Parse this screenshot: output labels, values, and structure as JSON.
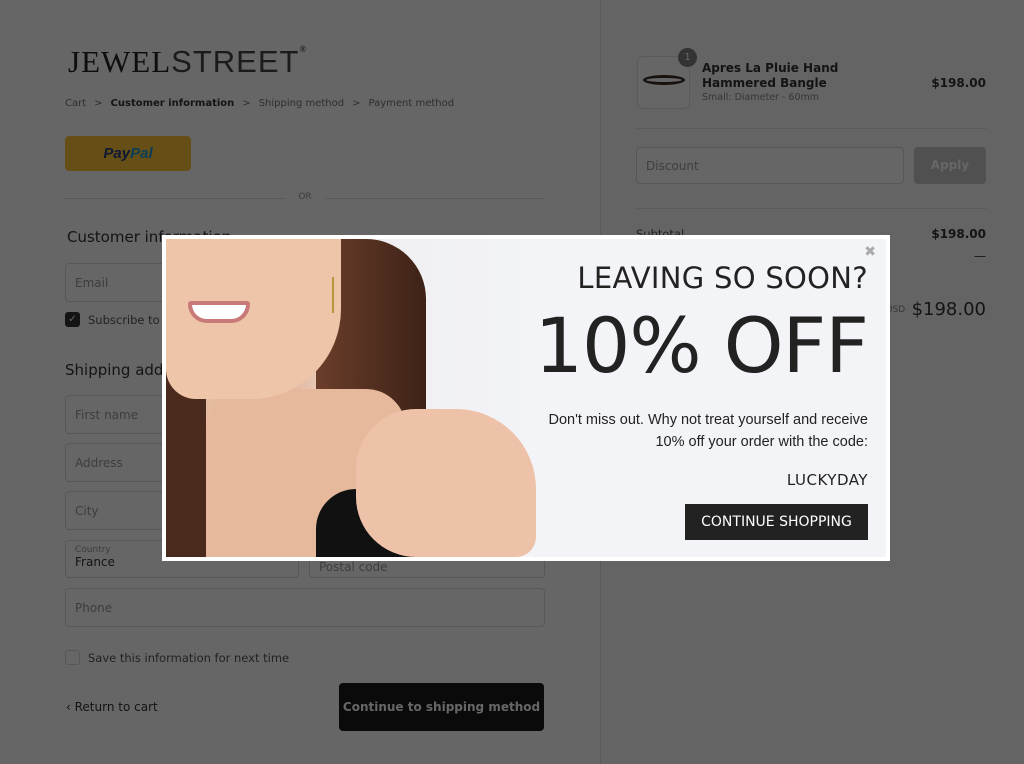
{
  "brand": {
    "logo_bold": "JEWEL",
    "logo_light": "STREET",
    "reg": "®"
  },
  "breadcrumb": [
    {
      "label": "Cart"
    },
    {
      "label": "Customer information"
    },
    {
      "label": "Shipping method"
    },
    {
      "label": "Payment method"
    }
  ],
  "breadcrumb_sep": ">",
  "paypal": {
    "part1": "Pay",
    "part2": "Pal"
  },
  "or": "OR",
  "customer": {
    "heading": "Customer information",
    "email_placeholder": "Email",
    "subscribe_label": "Subscribe to our newsletter",
    "subscribe_checked": true
  },
  "shipping": {
    "heading": "Shipping address",
    "first_name": "First name",
    "address": "Address",
    "city": "City",
    "country_label": "Country",
    "country_value": "France",
    "postal": "Postal code",
    "phone": "Phone",
    "save_label": "Save this information for next time",
    "save_checked": false
  },
  "actions": {
    "return": "Return to cart",
    "continue": "Continue to shipping method"
  },
  "cart": {
    "qty": "1",
    "name": "Apres La Pluie Hand Hammered Bangle",
    "variant": "Small: Diameter - 60mm",
    "price": "$198.00",
    "discount_placeholder": "Discount",
    "apply": "Apply",
    "subtotal_label": "Subtotal",
    "subtotal": "$198.00",
    "shipping_value": "—",
    "currency": "USD",
    "total": "$198.00"
  },
  "modal": {
    "close": "✖",
    "heading": "LEAVING SO SOON?",
    "offer": "10% OFF",
    "text": "Don't miss out. Why not treat yourself and receive 10% off your order with the code:",
    "code": "LUCKYDAY",
    "button": "CONTINUE SHOPPING"
  }
}
